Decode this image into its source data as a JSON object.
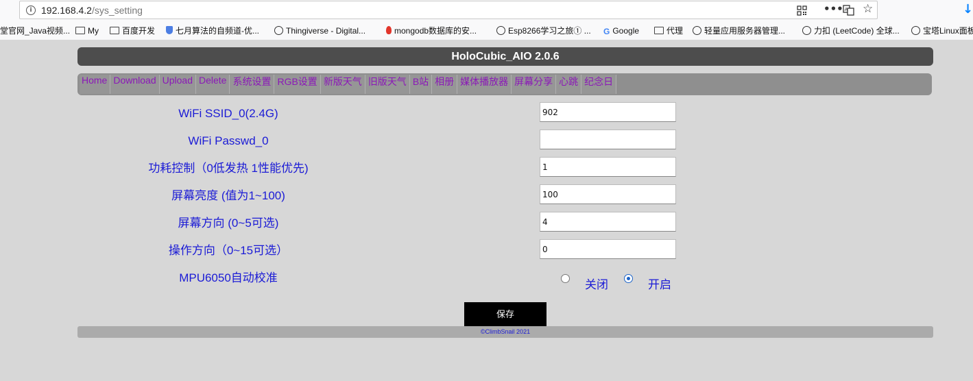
{
  "browser": {
    "url_host": "192.168.4.2",
    "url_path": "/sys_setting",
    "icons": [
      "info-icon",
      "qr-code-icon",
      "more-icon",
      "translate-icon",
      "star-icon",
      "download-icon"
    ],
    "bookmarks": [
      {
        "label": "堂官网_Java视频...",
        "icon": "none"
      },
      {
        "label": "My",
        "icon": "folder-icon"
      },
      {
        "label": "百度开发",
        "icon": "folder-icon"
      },
      {
        "label": "七月算法的自频道-优...",
        "icon": "site-icon"
      },
      {
        "label": "Thingiverse - Digital...",
        "icon": "globe-icon"
      },
      {
        "label": "mongodb数据库的安...",
        "icon": "flame-icon"
      },
      {
        "label": "Esp8266学习之旅① ...",
        "icon": "globe-icon"
      },
      {
        "label": "Google",
        "icon": "google-icon"
      },
      {
        "label": "代理",
        "icon": "folder-icon"
      },
      {
        "label": "轻量应用服务器管理...",
        "icon": "globe-icon"
      },
      {
        "label": "力扣 (LeetCode) 全球...",
        "icon": "globe-icon"
      },
      {
        "label": "宝塔Linux面板",
        "icon": "globe-icon"
      }
    ]
  },
  "page": {
    "title": "HoloCubic_AIO 2.0.6",
    "nav": [
      "Home",
      "Download",
      "Upload",
      "Delete",
      "系统设置",
      "RGB设置",
      "新版天气",
      "旧版天气",
      "B站",
      "相册",
      "媒体播放器",
      "屏幕分享",
      "心跳",
      "纪念日"
    ],
    "fields": [
      {
        "label": "WiFi SSID_0(2.4G)",
        "value": "902"
      },
      {
        "label": "WiFi Passwd_0",
        "value": ""
      },
      {
        "label": "功耗控制（0低发热 1性能优先)",
        "value": "1"
      },
      {
        "label": "屏幕亮度 (值为1~100)",
        "value": "100"
      },
      {
        "label": "屏幕方向 (0~5可选)",
        "value": "4"
      },
      {
        "label": "操作方向（0~15可选）",
        "value": "0"
      }
    ],
    "mpu": {
      "label": "MPU6050自动校准",
      "option_off": "关闭",
      "option_on": "开启",
      "selected": "开启"
    },
    "save_label": "保存",
    "footer": "©ClimbSnail 2021"
  },
  "colors": {
    "background": "#d7d7d7",
    "title_bar": "#4d4d4d",
    "nav_bar": "#8f8f8f",
    "nav_text": "#8b18b8",
    "label_text": "#1b1bd6",
    "save_button": "#000000"
  }
}
